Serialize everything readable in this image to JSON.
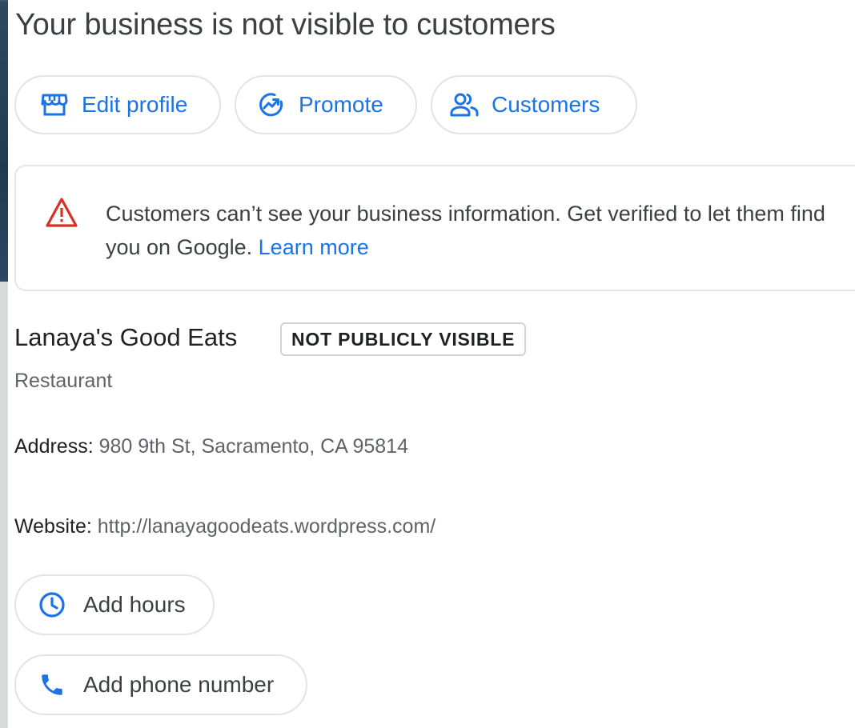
{
  "header": {
    "title": "Your business is not visible to customers"
  },
  "actions": {
    "edit_profile": {
      "label": "Edit profile",
      "icon": "storefront-icon"
    },
    "promote": {
      "label": "Promote",
      "icon": "trending-up-icon"
    },
    "customers": {
      "label": "Customers",
      "icon": "people-icon"
    }
  },
  "alert": {
    "icon": "warning-triangle-icon",
    "message": "Customers can’t see your business information. Get verified to let them find you on Google.",
    "link_label": "Learn more",
    "icon_color": "#d93025"
  },
  "business": {
    "name": "Lanaya's Good Eats",
    "badge": "NOT PUBLICLY VISIBLE",
    "category": "Restaurant",
    "address_key": "Address:",
    "address_value": "980 9th St, Sacramento, CA 95814",
    "website_key": "Website:",
    "website_value": "http://lanayagoodeats.wordpress.com/"
  },
  "quick_actions": {
    "add_hours": {
      "label": "Add hours",
      "icon": "clock-icon"
    },
    "add_phone": {
      "label": "Add phone number",
      "icon": "phone-icon"
    }
  },
  "colors": {
    "accent": "#1a73e8",
    "warning": "#d93025",
    "text_primary": "#202124",
    "text_secondary": "#5f6368"
  }
}
